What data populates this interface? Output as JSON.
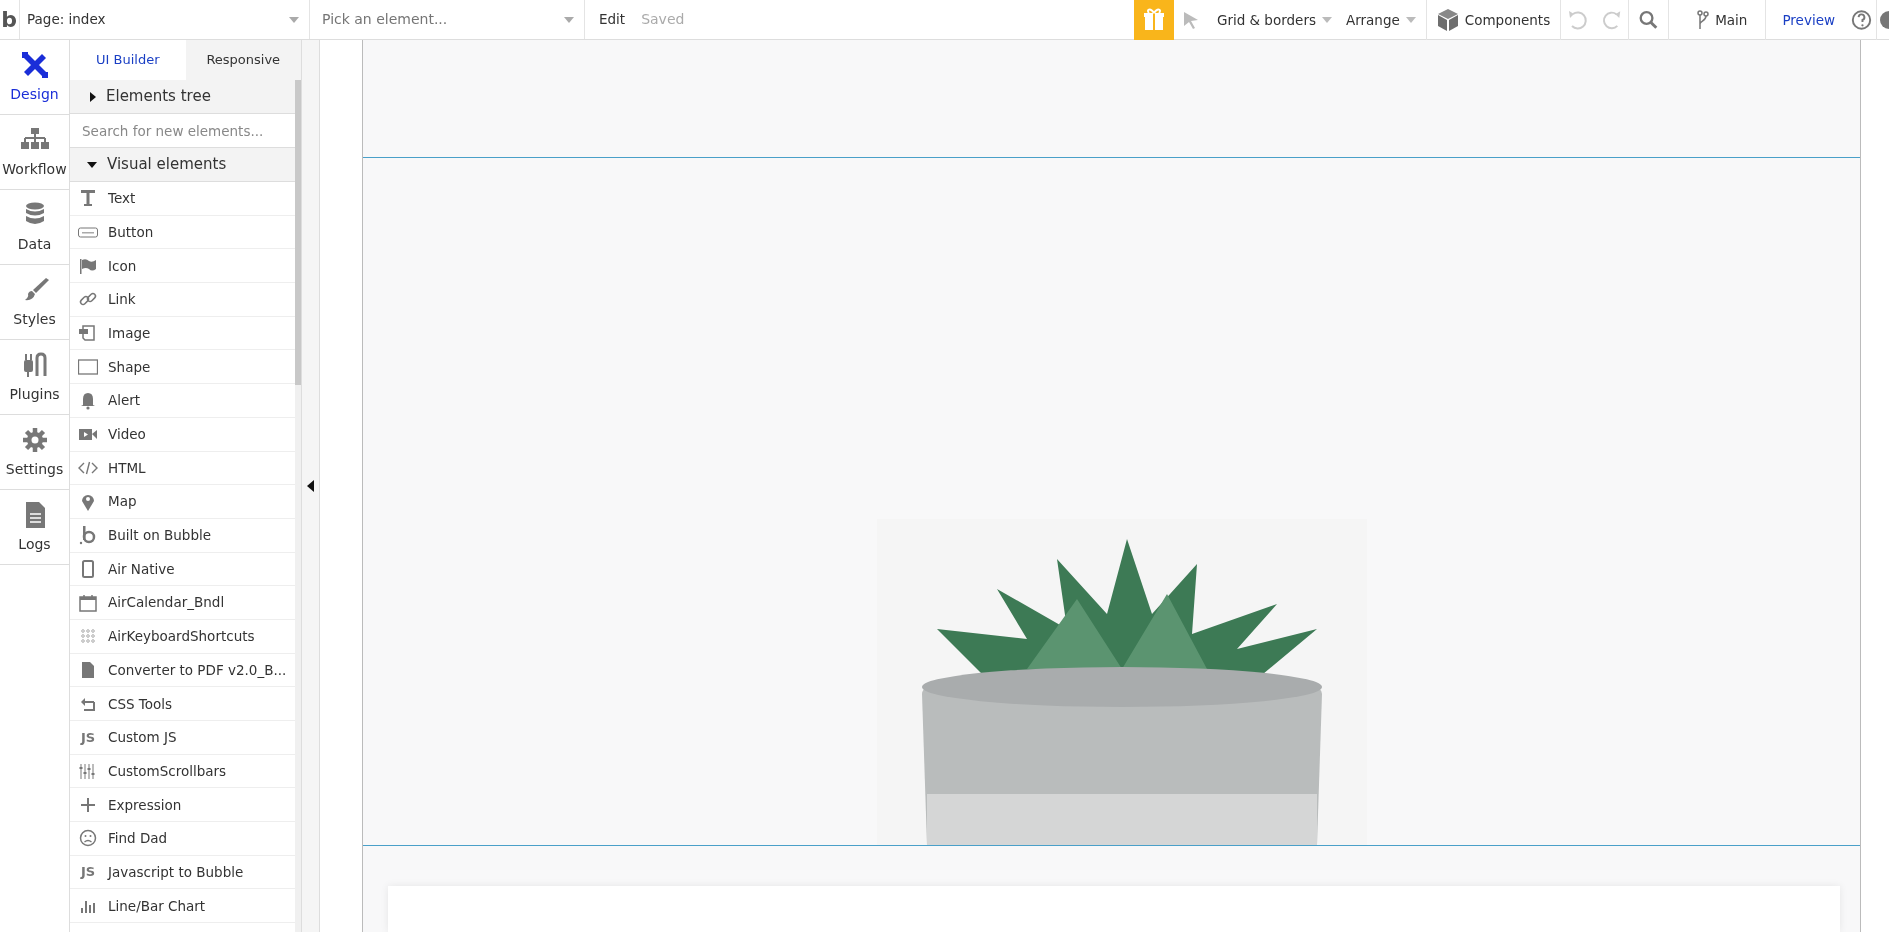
{
  "topbar": {
    "logo": "b",
    "page_select": "Page: index",
    "element_select": {
      "placeholder": "Pick an element..."
    },
    "edit": "Edit",
    "saved": "Saved",
    "grid_menu": "Grid & borders",
    "arrange_menu": "Arrange",
    "components": "Components",
    "branch": "Main",
    "preview": "Preview"
  },
  "rail": [
    {
      "label": "Design",
      "selected": true
    },
    {
      "label": "Workflow",
      "selected": false
    },
    {
      "label": "Data",
      "selected": false
    },
    {
      "label": "Styles",
      "selected": false
    },
    {
      "label": "Plugins",
      "selected": false
    },
    {
      "label": "Settings",
      "selected": false
    },
    {
      "label": "Logs",
      "selected": false
    }
  ],
  "panel": {
    "tabs": [
      {
        "label": "UI Builder",
        "selected": true
      },
      {
        "label": "Responsive",
        "selected": false
      }
    ],
    "elements_tree": {
      "title": "Elements tree",
      "expanded": false
    },
    "search": {
      "placeholder": "Search for new elements..."
    },
    "visual_elements": {
      "title": "Visual elements",
      "expanded": true,
      "items": [
        {
          "label": "Text"
        },
        {
          "label": "Button"
        },
        {
          "label": "Icon"
        },
        {
          "label": "Link"
        },
        {
          "label": "Image"
        },
        {
          "label": "Shape"
        },
        {
          "label": "Alert"
        },
        {
          "label": "Video"
        },
        {
          "label": "HTML"
        },
        {
          "label": "Map"
        },
        {
          "label": "Built on Bubble"
        },
        {
          "label": "Air Native"
        },
        {
          "label": "AirCalendar_Bndl"
        },
        {
          "label": "AirKeyboardShortcuts"
        },
        {
          "label": "Converter to PDF v2.0_B..."
        },
        {
          "label": "CSS Tools"
        },
        {
          "label": "Custom JS",
          "icon_text": "JS"
        },
        {
          "label": "CustomScrollbars"
        },
        {
          "label": "Expression"
        },
        {
          "label": "Find Dad"
        },
        {
          "label": "Javascript to Bubble",
          "icon_text": "JS"
        },
        {
          "label": "Line/Bar Chart"
        }
      ]
    }
  }
}
